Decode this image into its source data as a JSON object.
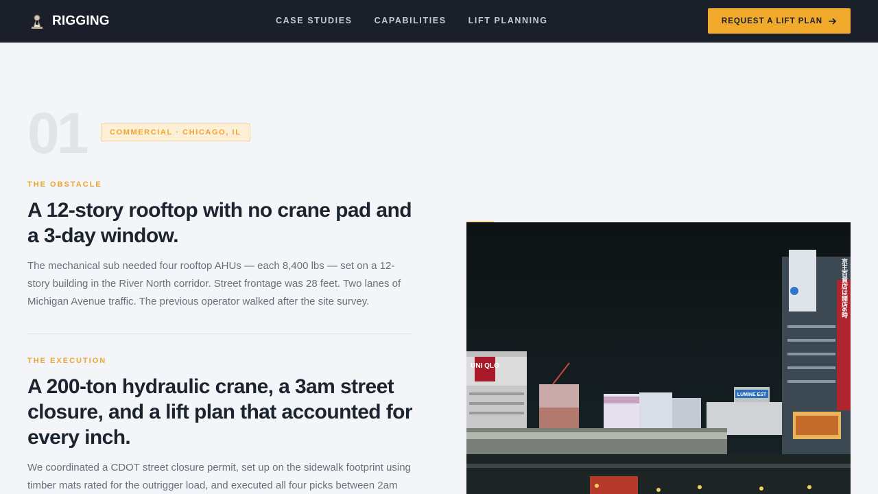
{
  "header": {
    "brand": "RIGGING",
    "nav": [
      "CASE STUDIES",
      "CAPABILITIES",
      "LIFT PLANNING"
    ],
    "cta_label": "REQUEST A LIFT PLAN"
  },
  "case": {
    "number": "01",
    "tag": "COMMERCIAL · CHICAGO, IL",
    "obstacle": {
      "eyebrow": "THE OBSTACLE",
      "headline": "A 12-story rooftop with no crane pad and a 3-day window.",
      "body": "The mechanical sub needed four rooftop AHUs — each 8,400 lbs — set on a 12-story building in the River North corridor. Street frontage was 28 feet. Two lanes of Michigan Avenue traffic. The previous operator walked after the site survey."
    },
    "execution": {
      "eyebrow": "THE EXECUTION",
      "headline": "A 200-ton hydraulic crane, a 3am street closure, and a lift plan that accounted for every inch.",
      "body": "We coordinated a CDOT street closure permit, set up on the sidewalk footprint using timber mats rated for the outrigger load, and executed all four picks between 2am"
    }
  },
  "photo": {
    "signs": [
      "UNI QLO",
      "LUMINE EST",
      "京王百貨店は開店6時"
    ]
  },
  "colors": {
    "accent": "#f0a92a",
    "header_bg": "#1b1f29",
    "page_bg": "#f3f5f8"
  }
}
